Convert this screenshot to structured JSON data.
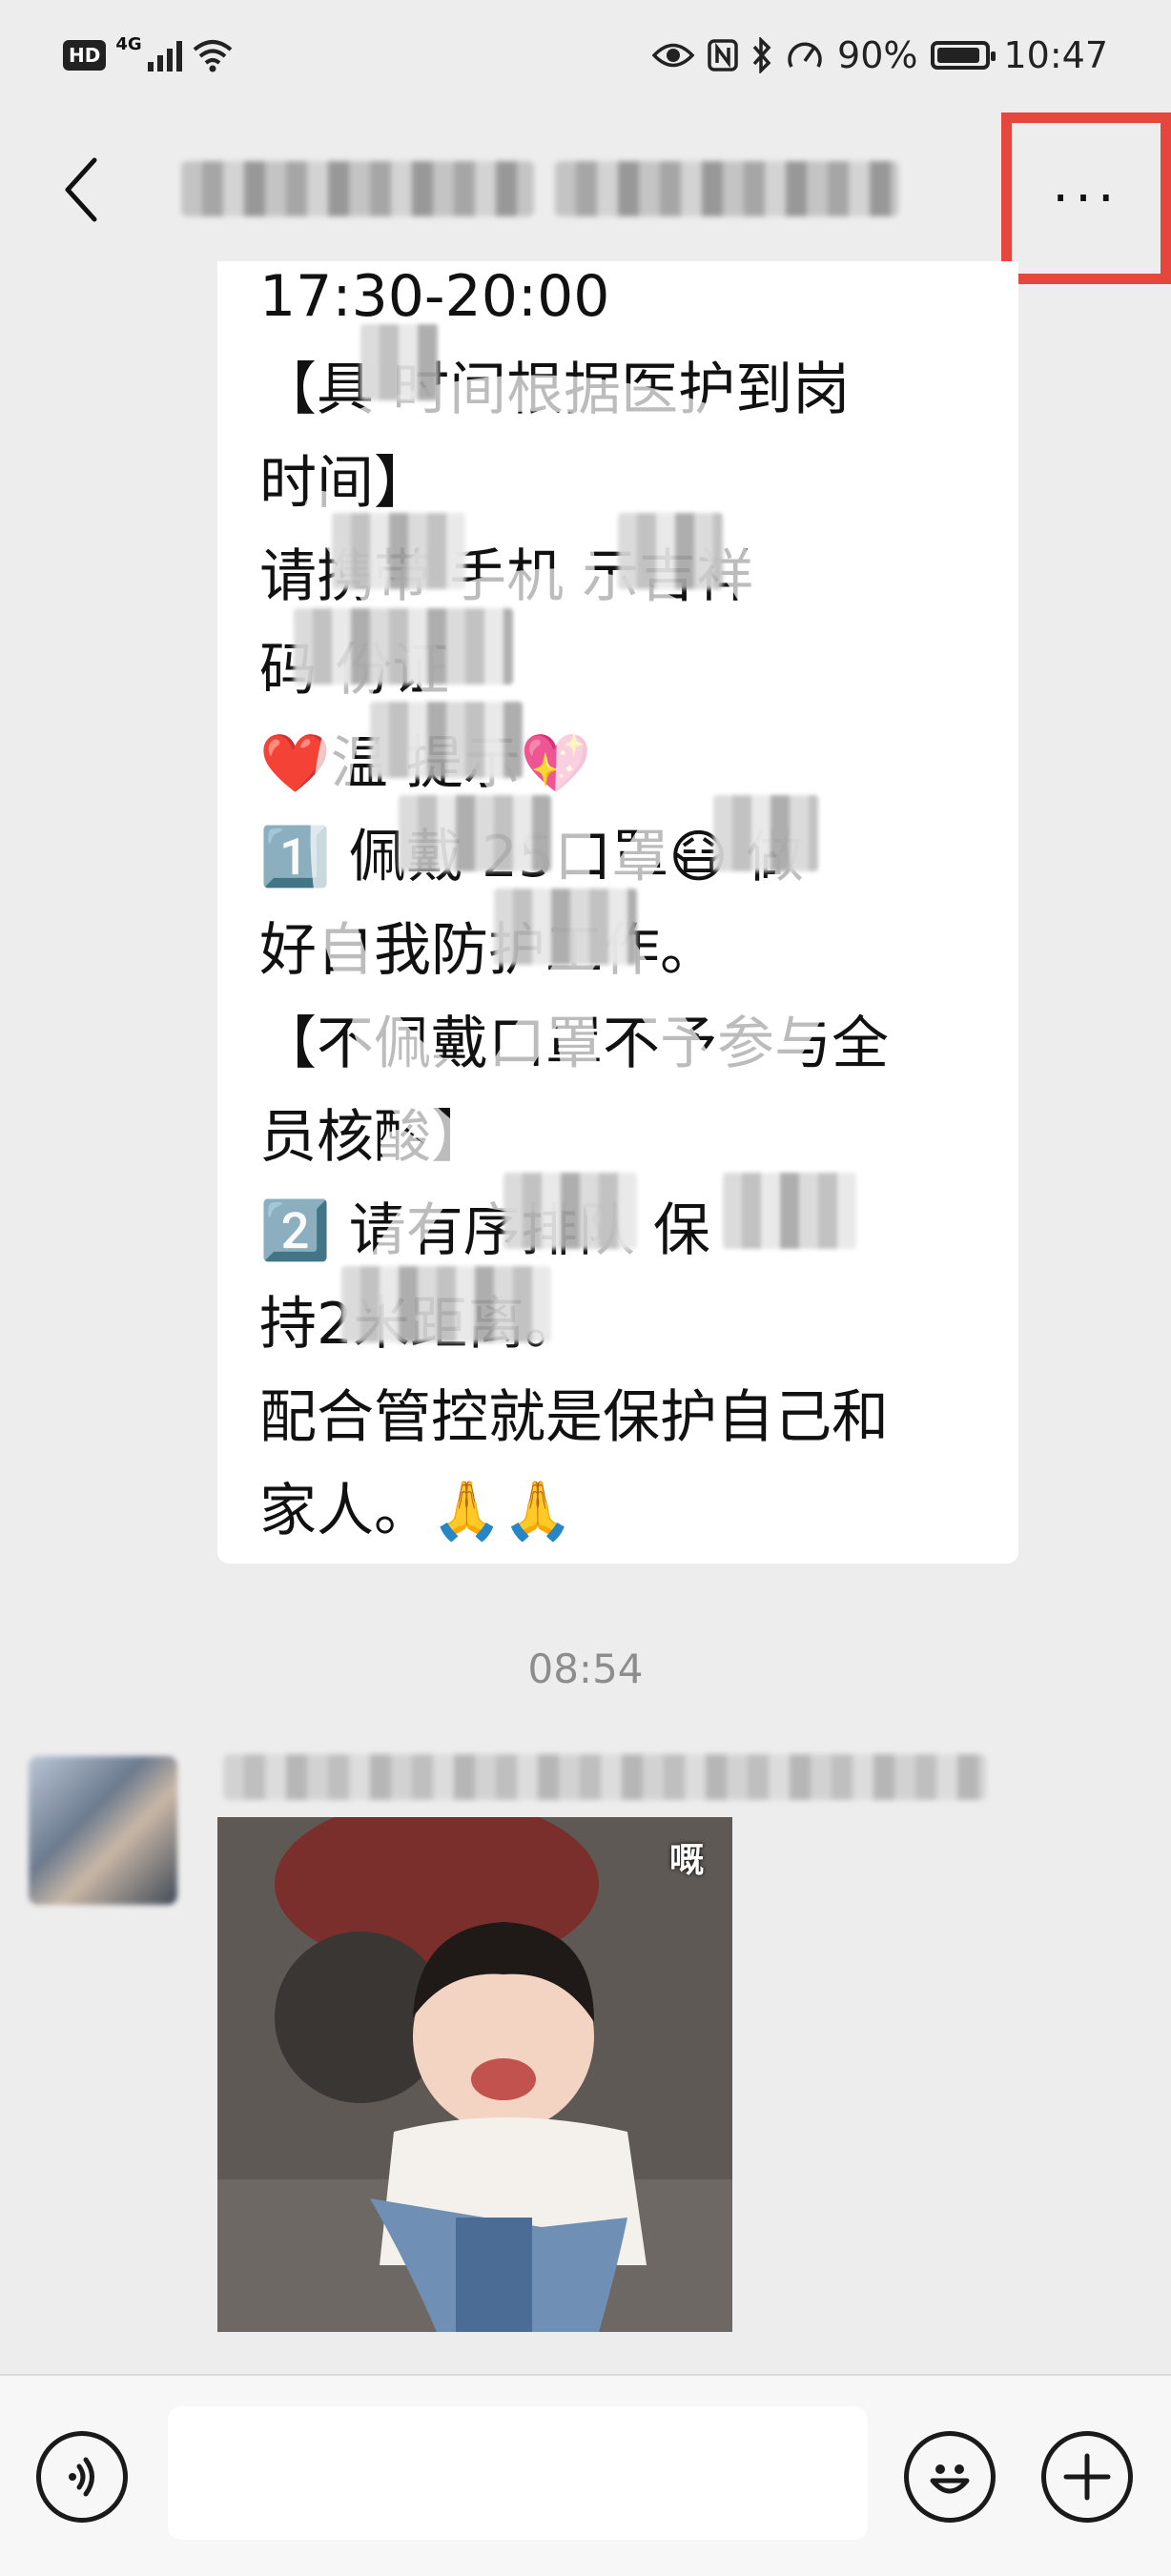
{
  "status_bar": {
    "hd": "HD",
    "network": "4G",
    "battery": "90%",
    "battery_level": 0.9,
    "time": "10:47"
  },
  "header": {
    "more_label": "···"
  },
  "message": {
    "lines": [
      "17:30-20:00",
      "【具 时间根据医护到岗",
      "时间】",
      "请携带 手机 示吉祥",
      "码 份证",
      "❤️温 提示💖",
      "1️⃣ 佩戴 25口罩😷 做",
      "好自我防护工作。",
      "【不佩戴口罩不予参与全",
      "员核酸】",
      "2️⃣ 请有序排队 保",
      "持2米距离。",
      "配合管控就是保护自己和",
      "家人。🙏🙏"
    ]
  },
  "chat": {
    "timestamp": "08:54",
    "sticker_caption": "嘅"
  },
  "input_bar": {
    "placeholder": ""
  },
  "colors": {
    "highlight": "#e5473c",
    "background": "#ededed"
  },
  "icons": [
    "back-chevron-icon",
    "more-icon",
    "voice-icon",
    "emoji-icon",
    "plus-icon"
  ]
}
